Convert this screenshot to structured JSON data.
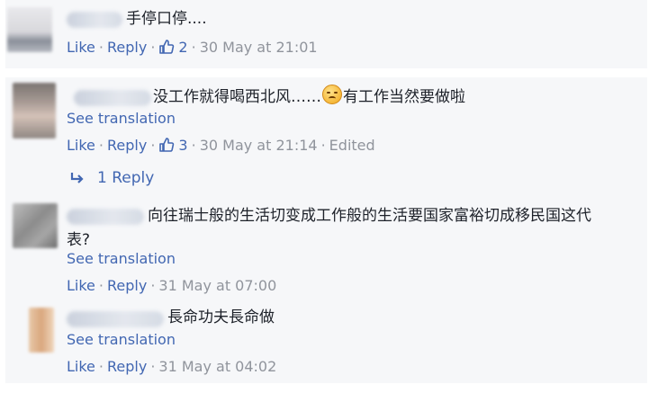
{
  "comments": [
    {
      "text": "手停口停....",
      "like": "Like",
      "reply": "Reply",
      "likes": "2",
      "time": "30 May at 21:01"
    },
    {
      "text_a": "没工作就得喝西北风……",
      "text_b": "有工作当然要做啦",
      "emoji": "disappointed-face-emoji",
      "see_translation": "See translation",
      "like": "Like",
      "reply": "Reply",
      "likes": "3",
      "time": "30 May at 21:14",
      "edited": "Edited",
      "replies_label": "1 Reply"
    },
    {
      "text_line1": "向往瑞士般的生活切变成工作般的生活要国家富裕切成移民国这代",
      "text_line2": "表?",
      "see_translation": "See translation",
      "like": "Like",
      "reply": "Reply",
      "time": "31 May at 07:00"
    },
    {
      "text": "長命功夫長命做",
      "see_translation": "See translation",
      "like": "Like",
      "reply": "Reply",
      "time": "31 May at 04:02"
    }
  ],
  "colors": {
    "link": "#4267b2",
    "meta": "#90949c",
    "panel": "#f6f7f9",
    "text": "#1d2129"
  }
}
